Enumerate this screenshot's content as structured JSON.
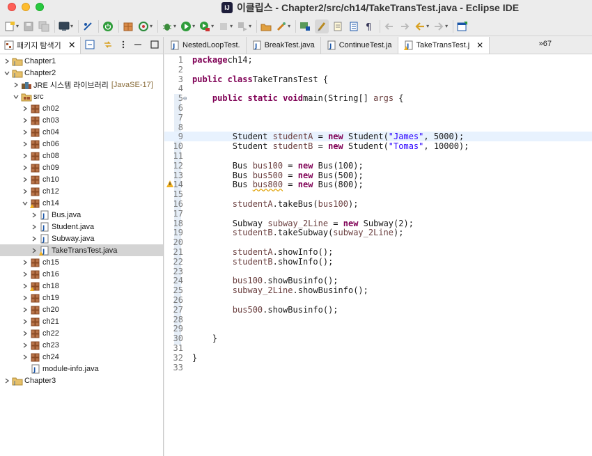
{
  "window": {
    "title": "이클립스 - Chapter2/src/ch14/TakeTransTest.java - Eclipse IDE",
    "app_icon_text": "IJ"
  },
  "toolbar": {
    "buttons": [
      "new-icon",
      "save-icon",
      "save-all-icon",
      "terminal-icon",
      "debug-skip-icon",
      "power-icon",
      "package-icon",
      "refresh-icon",
      "bug-icon",
      "run-icon",
      "run-coverage-icon",
      "stop-icon",
      "build-icon",
      "open-type-icon",
      "tools-icon",
      "annotation-icon",
      "highlight-icon",
      "doc-icon",
      "outline-icon",
      "paragraph-icon",
      "back-icon",
      "forward-icon",
      "nav-back-icon",
      "nav-forward-icon",
      "perspective-icon"
    ]
  },
  "explorer": {
    "tab_label": "패키지 탐색기",
    "jre_label": "JRE 시스템 라이브러리",
    "jre_version": "[JavaSE-17]",
    "items": [
      {
        "label": "Chapter1",
        "indent": 0,
        "kind": "project",
        "expanded": false
      },
      {
        "label": "Chapter2",
        "indent": 0,
        "kind": "project",
        "expanded": true
      },
      {
        "label": "JRE",
        "indent": 1,
        "kind": "jre",
        "expanded": false
      },
      {
        "label": "src",
        "indent": 1,
        "kind": "src",
        "expanded": true
      },
      {
        "label": "ch02",
        "indent": 2,
        "kind": "package",
        "expanded": false
      },
      {
        "label": "ch03",
        "indent": 2,
        "kind": "package",
        "expanded": false
      },
      {
        "label": "ch04",
        "indent": 2,
        "kind": "package",
        "expanded": false
      },
      {
        "label": "ch06",
        "indent": 2,
        "kind": "package",
        "expanded": false
      },
      {
        "label": "ch08",
        "indent": 2,
        "kind": "package",
        "expanded": false
      },
      {
        "label": "ch09",
        "indent": 2,
        "kind": "package",
        "expanded": false
      },
      {
        "label": "ch10",
        "indent": 2,
        "kind": "package",
        "expanded": false
      },
      {
        "label": "ch12",
        "indent": 2,
        "kind": "package",
        "expanded": false
      },
      {
        "label": "ch14",
        "indent": 2,
        "kind": "package-warn",
        "expanded": true
      },
      {
        "label": "Bus.java",
        "indent": 3,
        "kind": "java",
        "expanded": false
      },
      {
        "label": "Student.java",
        "indent": 3,
        "kind": "java",
        "expanded": false
      },
      {
        "label": "Subway.java",
        "indent": 3,
        "kind": "java",
        "expanded": false
      },
      {
        "label": "TakeTransTest.java",
        "indent": 3,
        "kind": "java-warn",
        "expanded": false,
        "selected": true
      },
      {
        "label": "ch15",
        "indent": 2,
        "kind": "package",
        "expanded": false
      },
      {
        "label": "ch16",
        "indent": 2,
        "kind": "package",
        "expanded": false
      },
      {
        "label": "ch18",
        "indent": 2,
        "kind": "package-warn",
        "expanded": false
      },
      {
        "label": "ch19",
        "indent": 2,
        "kind": "package",
        "expanded": false
      },
      {
        "label": "ch20",
        "indent": 2,
        "kind": "package",
        "expanded": false
      },
      {
        "label": "ch21",
        "indent": 2,
        "kind": "package",
        "expanded": false
      },
      {
        "label": "ch22",
        "indent": 2,
        "kind": "package",
        "expanded": false
      },
      {
        "label": "ch23",
        "indent": 2,
        "kind": "package",
        "expanded": false
      },
      {
        "label": "ch24",
        "indent": 2,
        "kind": "package",
        "expanded": false
      },
      {
        "label": "module-info.java",
        "indent": 2,
        "kind": "module",
        "expanded": null
      },
      {
        "label": "Chapter3",
        "indent": 0,
        "kind": "project",
        "expanded": false
      }
    ]
  },
  "editor": {
    "tabs": [
      {
        "label": "NestedLoopTest.",
        "active": false
      },
      {
        "label": "BreakTest.java",
        "active": false
      },
      {
        "label": "ContinueTest.ja",
        "active": false
      },
      {
        "label": "TakeTransTest.j",
        "active": true
      }
    ],
    "overflow_label": "»67",
    "current_line": 9,
    "lines": [
      {
        "n": "1",
        "tokens": [
          [
            "kw",
            "package"
          ],
          [
            "",
            "ch14;"
          ]
        ]
      },
      {
        "n": "2",
        "tokens": []
      },
      {
        "n": "3",
        "tokens": [
          [
            "kw",
            "public"
          ],
          [
            "",
            ""
          ],
          [
            "kw",
            "class"
          ],
          [
            "",
            "TakeTransTest {"
          ]
        ]
      },
      {
        "n": "4",
        "tokens": []
      },
      {
        "n": "5",
        "tokens": [
          [
            "",
            "    "
          ],
          [
            "kw",
            "public"
          ],
          [
            "",
            ""
          ],
          [
            "kw",
            "static"
          ],
          [
            "",
            ""
          ],
          [
            "kw",
            "void"
          ],
          [
            "",
            "main(String[] "
          ],
          [
            "var",
            "args"
          ],
          [
            "",
            " {"
          ]
        ],
        "fold": true
      },
      {
        "n": "6",
        "tokens": []
      },
      {
        "n": "7",
        "tokens": []
      },
      {
        "n": "8",
        "tokens": []
      },
      {
        "n": "9",
        "tokens": [
          [
            "",
            "        Student "
          ],
          [
            "var",
            "studentA"
          ],
          [
            "",
            " = "
          ],
          [
            "kw",
            "new"
          ],
          [
            "",
            " Student("
          ],
          [
            "str",
            "\"James\""
          ],
          [
            "",
            ", 5000);"
          ]
        ]
      },
      {
        "n": "10",
        "tokens": [
          [
            "",
            "        Student "
          ],
          [
            "var",
            "studentB"
          ],
          [
            "",
            " = "
          ],
          [
            "kw",
            "new"
          ],
          [
            "",
            " Student("
          ],
          [
            "str",
            "\"Tomas\""
          ],
          [
            "",
            ", 10000);"
          ]
        ]
      },
      {
        "n": "11",
        "tokens": []
      },
      {
        "n": "12",
        "tokens": [
          [
            "",
            "        Bus "
          ],
          [
            "var",
            "bus100"
          ],
          [
            "",
            " = "
          ],
          [
            "kw",
            "new"
          ],
          [
            "",
            " Bus(100);"
          ]
        ]
      },
      {
        "n": "13",
        "tokens": [
          [
            "",
            "        Bus "
          ],
          [
            "var",
            "bus500"
          ],
          [
            "",
            " = "
          ],
          [
            "kw",
            "new"
          ],
          [
            "",
            " Bus(500);"
          ]
        ]
      },
      {
        "n": "14",
        "tokens": [
          [
            "",
            "        Bus "
          ],
          [
            "var warn",
            "bus800"
          ],
          [
            "",
            " = "
          ],
          [
            "kw",
            "new"
          ],
          [
            "",
            " Bus(800);"
          ]
        ],
        "warn": true
      },
      {
        "n": "15",
        "tokens": []
      },
      {
        "n": "16",
        "tokens": [
          [
            "",
            "        "
          ],
          [
            "var",
            "studentA"
          ],
          [
            "",
            ".takeBus("
          ],
          [
            "var",
            "bus100"
          ],
          [
            "",
            ");"
          ]
        ]
      },
      {
        "n": "17",
        "tokens": []
      },
      {
        "n": "18",
        "tokens": [
          [
            "",
            "        Subway "
          ],
          [
            "var",
            "subway_2Line"
          ],
          [
            "",
            " = "
          ],
          [
            "kw",
            "new"
          ],
          [
            "",
            " Subway(2);"
          ]
        ]
      },
      {
        "n": "19",
        "tokens": [
          [
            "",
            "        "
          ],
          [
            "var",
            "studentB"
          ],
          [
            "",
            ".takeSubway("
          ],
          [
            "var",
            "subway_2Line"
          ],
          [
            "",
            ");"
          ]
        ]
      },
      {
        "n": "20",
        "tokens": []
      },
      {
        "n": "21",
        "tokens": [
          [
            "",
            "        "
          ],
          [
            "var",
            "studentA"
          ],
          [
            "",
            ".showInfo();"
          ]
        ]
      },
      {
        "n": "22",
        "tokens": [
          [
            "",
            "        "
          ],
          [
            "var",
            "studentB"
          ],
          [
            "",
            ".showInfo();"
          ]
        ]
      },
      {
        "n": "23",
        "tokens": []
      },
      {
        "n": "24",
        "tokens": [
          [
            "",
            "        "
          ],
          [
            "var",
            "bus100"
          ],
          [
            "",
            ".showBusinfo();"
          ]
        ]
      },
      {
        "n": "25",
        "tokens": [
          [
            "",
            "        "
          ],
          [
            "var",
            "subway_2Line"
          ],
          [
            "",
            ".showBusinfo();"
          ]
        ]
      },
      {
        "n": "26",
        "tokens": []
      },
      {
        "n": "27",
        "tokens": [
          [
            "",
            "        "
          ],
          [
            "var",
            "bus500"
          ],
          [
            "",
            ".showBusinfo();"
          ]
        ]
      },
      {
        "n": "28",
        "tokens": []
      },
      {
        "n": "29",
        "tokens": []
      },
      {
        "n": "30",
        "tokens": [
          [
            "",
            "    }"
          ]
        ]
      },
      {
        "n": "31",
        "tokens": []
      },
      {
        "n": "32",
        "tokens": [
          [
            "",
            "}"
          ]
        ]
      },
      {
        "n": "33",
        "tokens": []
      }
    ]
  },
  "colors": {
    "keyword": "#7f0055",
    "string": "#2a00ff",
    "variable": "#6a3e3e",
    "selection": "#d4d4d4",
    "current_line": "#e8f2fe"
  }
}
